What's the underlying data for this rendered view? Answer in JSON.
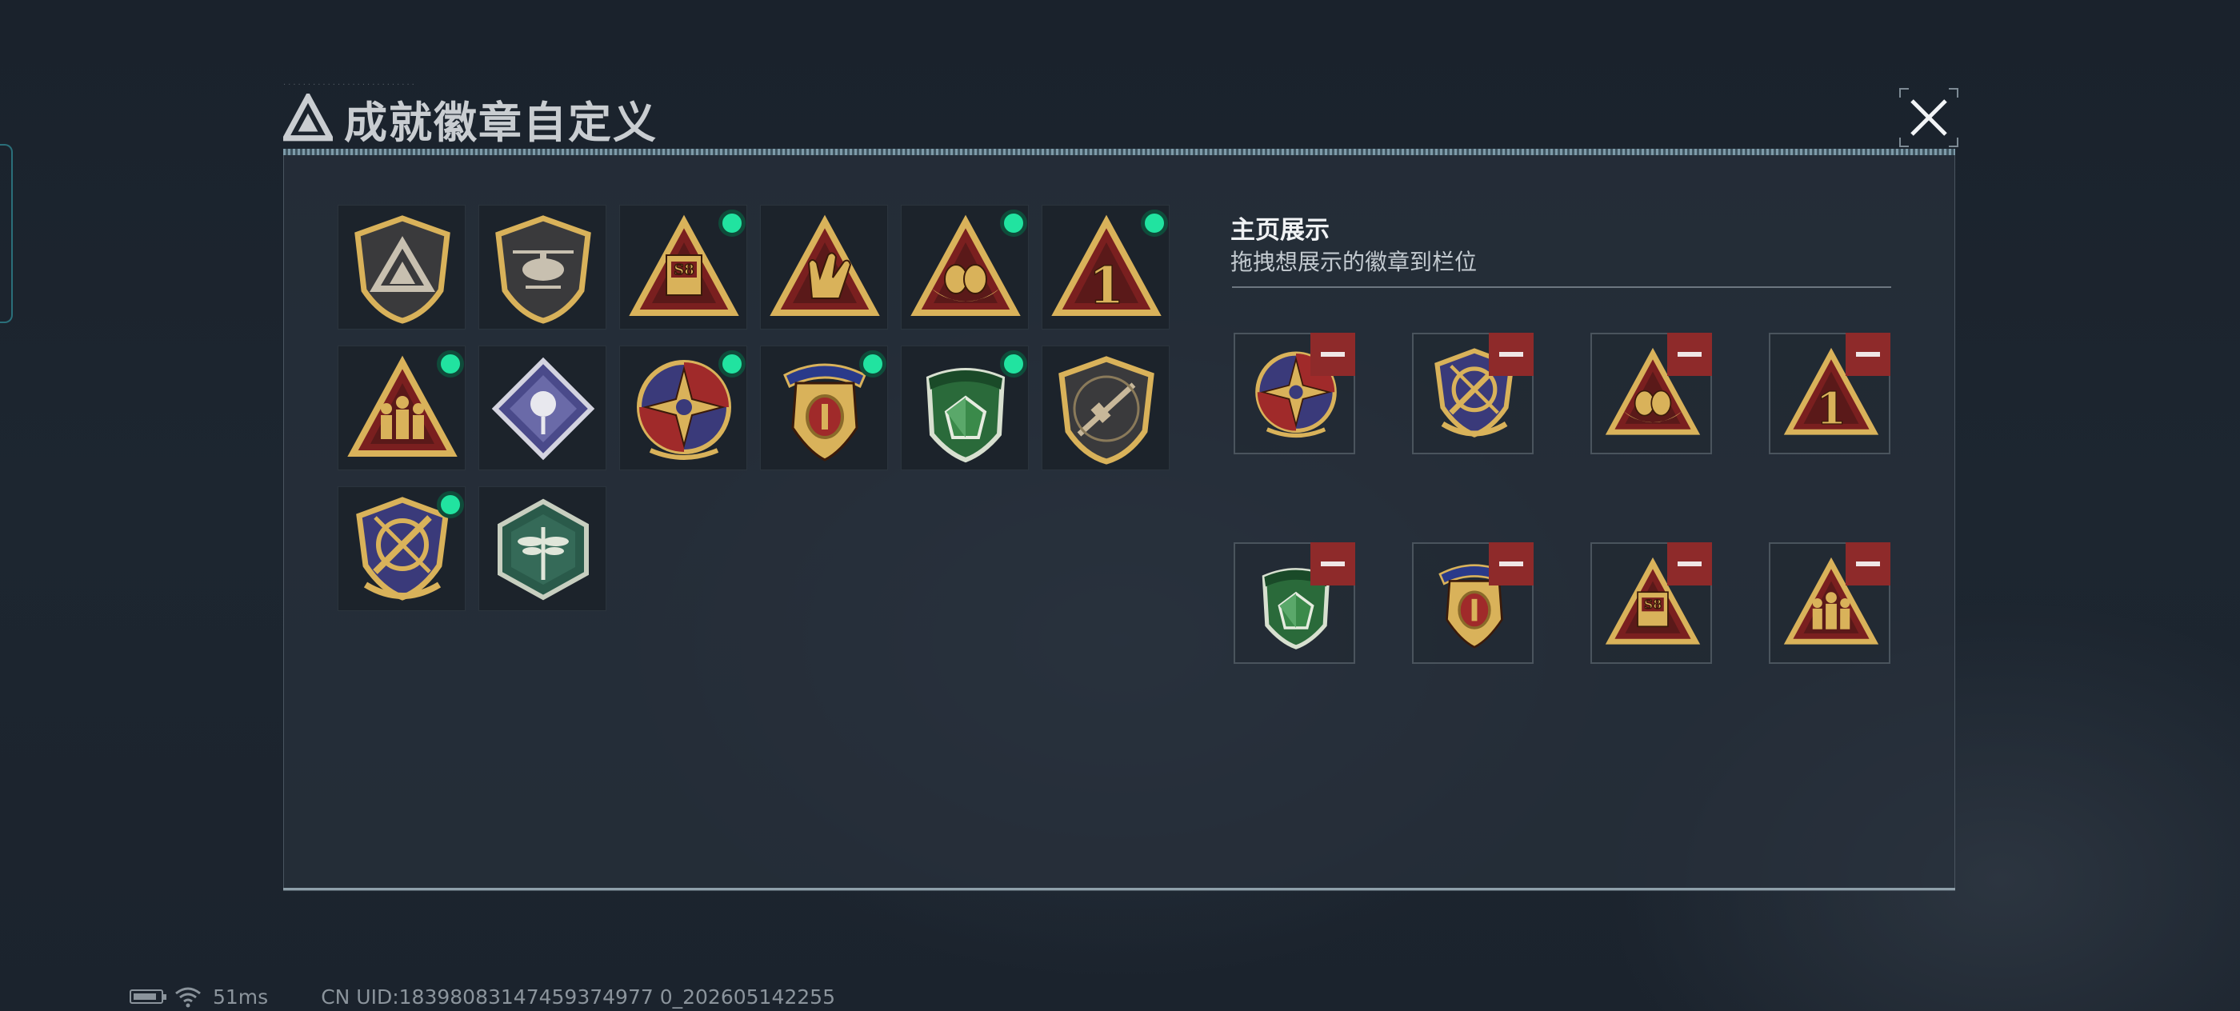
{
  "window": {
    "title": "成就徽章自定义",
    "title_deco_dots": "..........................."
  },
  "showcase": {
    "title": "主页展示",
    "subtitle": "拖拽想展示的徽章到栏位"
  },
  "badges": [
    {
      "icon": "triangle-logo-shield-badge",
      "owned_new": false
    },
    {
      "icon": "helicopter-shield-badge",
      "owned_new": false
    },
    {
      "icon": "s8-tower-triangle-badge",
      "owned_new": true,
      "label": "S8"
    },
    {
      "icon": "shaka-hand-triangle-badge",
      "owned_new": false
    },
    {
      "icon": "eggs-nest-triangle-badge",
      "owned_new": true
    },
    {
      "icon": "number-one-triangle-badge",
      "owned_new": true,
      "label": "1"
    },
    {
      "icon": "soldiers-triangle-badge",
      "owned_new": true
    },
    {
      "icon": "rose-diamond-badge",
      "owned_new": false
    },
    {
      "icon": "compass-star-round-badge",
      "owned_new": true
    },
    {
      "icon": "winged-emblem-banner-badge",
      "owned_new": true
    },
    {
      "icon": "green-gem-shield-badge",
      "owned_new": true
    },
    {
      "icon": "rifle-shield-badge",
      "owned_new": false
    },
    {
      "icon": "crossed-swords-wreath-badge",
      "owned_new": true
    },
    {
      "icon": "dragonfly-hexagon-badge",
      "owned_new": false
    }
  ],
  "slots": [
    {
      "icon": "compass-star-round-badge"
    },
    {
      "icon": "crossed-swords-wreath-badge"
    },
    {
      "icon": "eggs-nest-triangle-badge"
    },
    {
      "icon": "number-one-triangle-badge",
      "label": "1"
    },
    {
      "icon": "green-gem-shield-badge"
    },
    {
      "icon": "winged-emblem-banner-badge"
    },
    {
      "icon": "s8-tower-triangle-badge",
      "label": "S8"
    },
    {
      "icon": "soldiers-triangle-badge"
    }
  ],
  "status": {
    "ping": "51ms",
    "uid": "CN UID:18398083147459374977 0_202605142255"
  },
  "colors": {
    "gold": "#d9b25a",
    "dark_red": "#7a1f1f",
    "new_dot": "#21e3a0",
    "remove_red": "#8e2a2a"
  }
}
